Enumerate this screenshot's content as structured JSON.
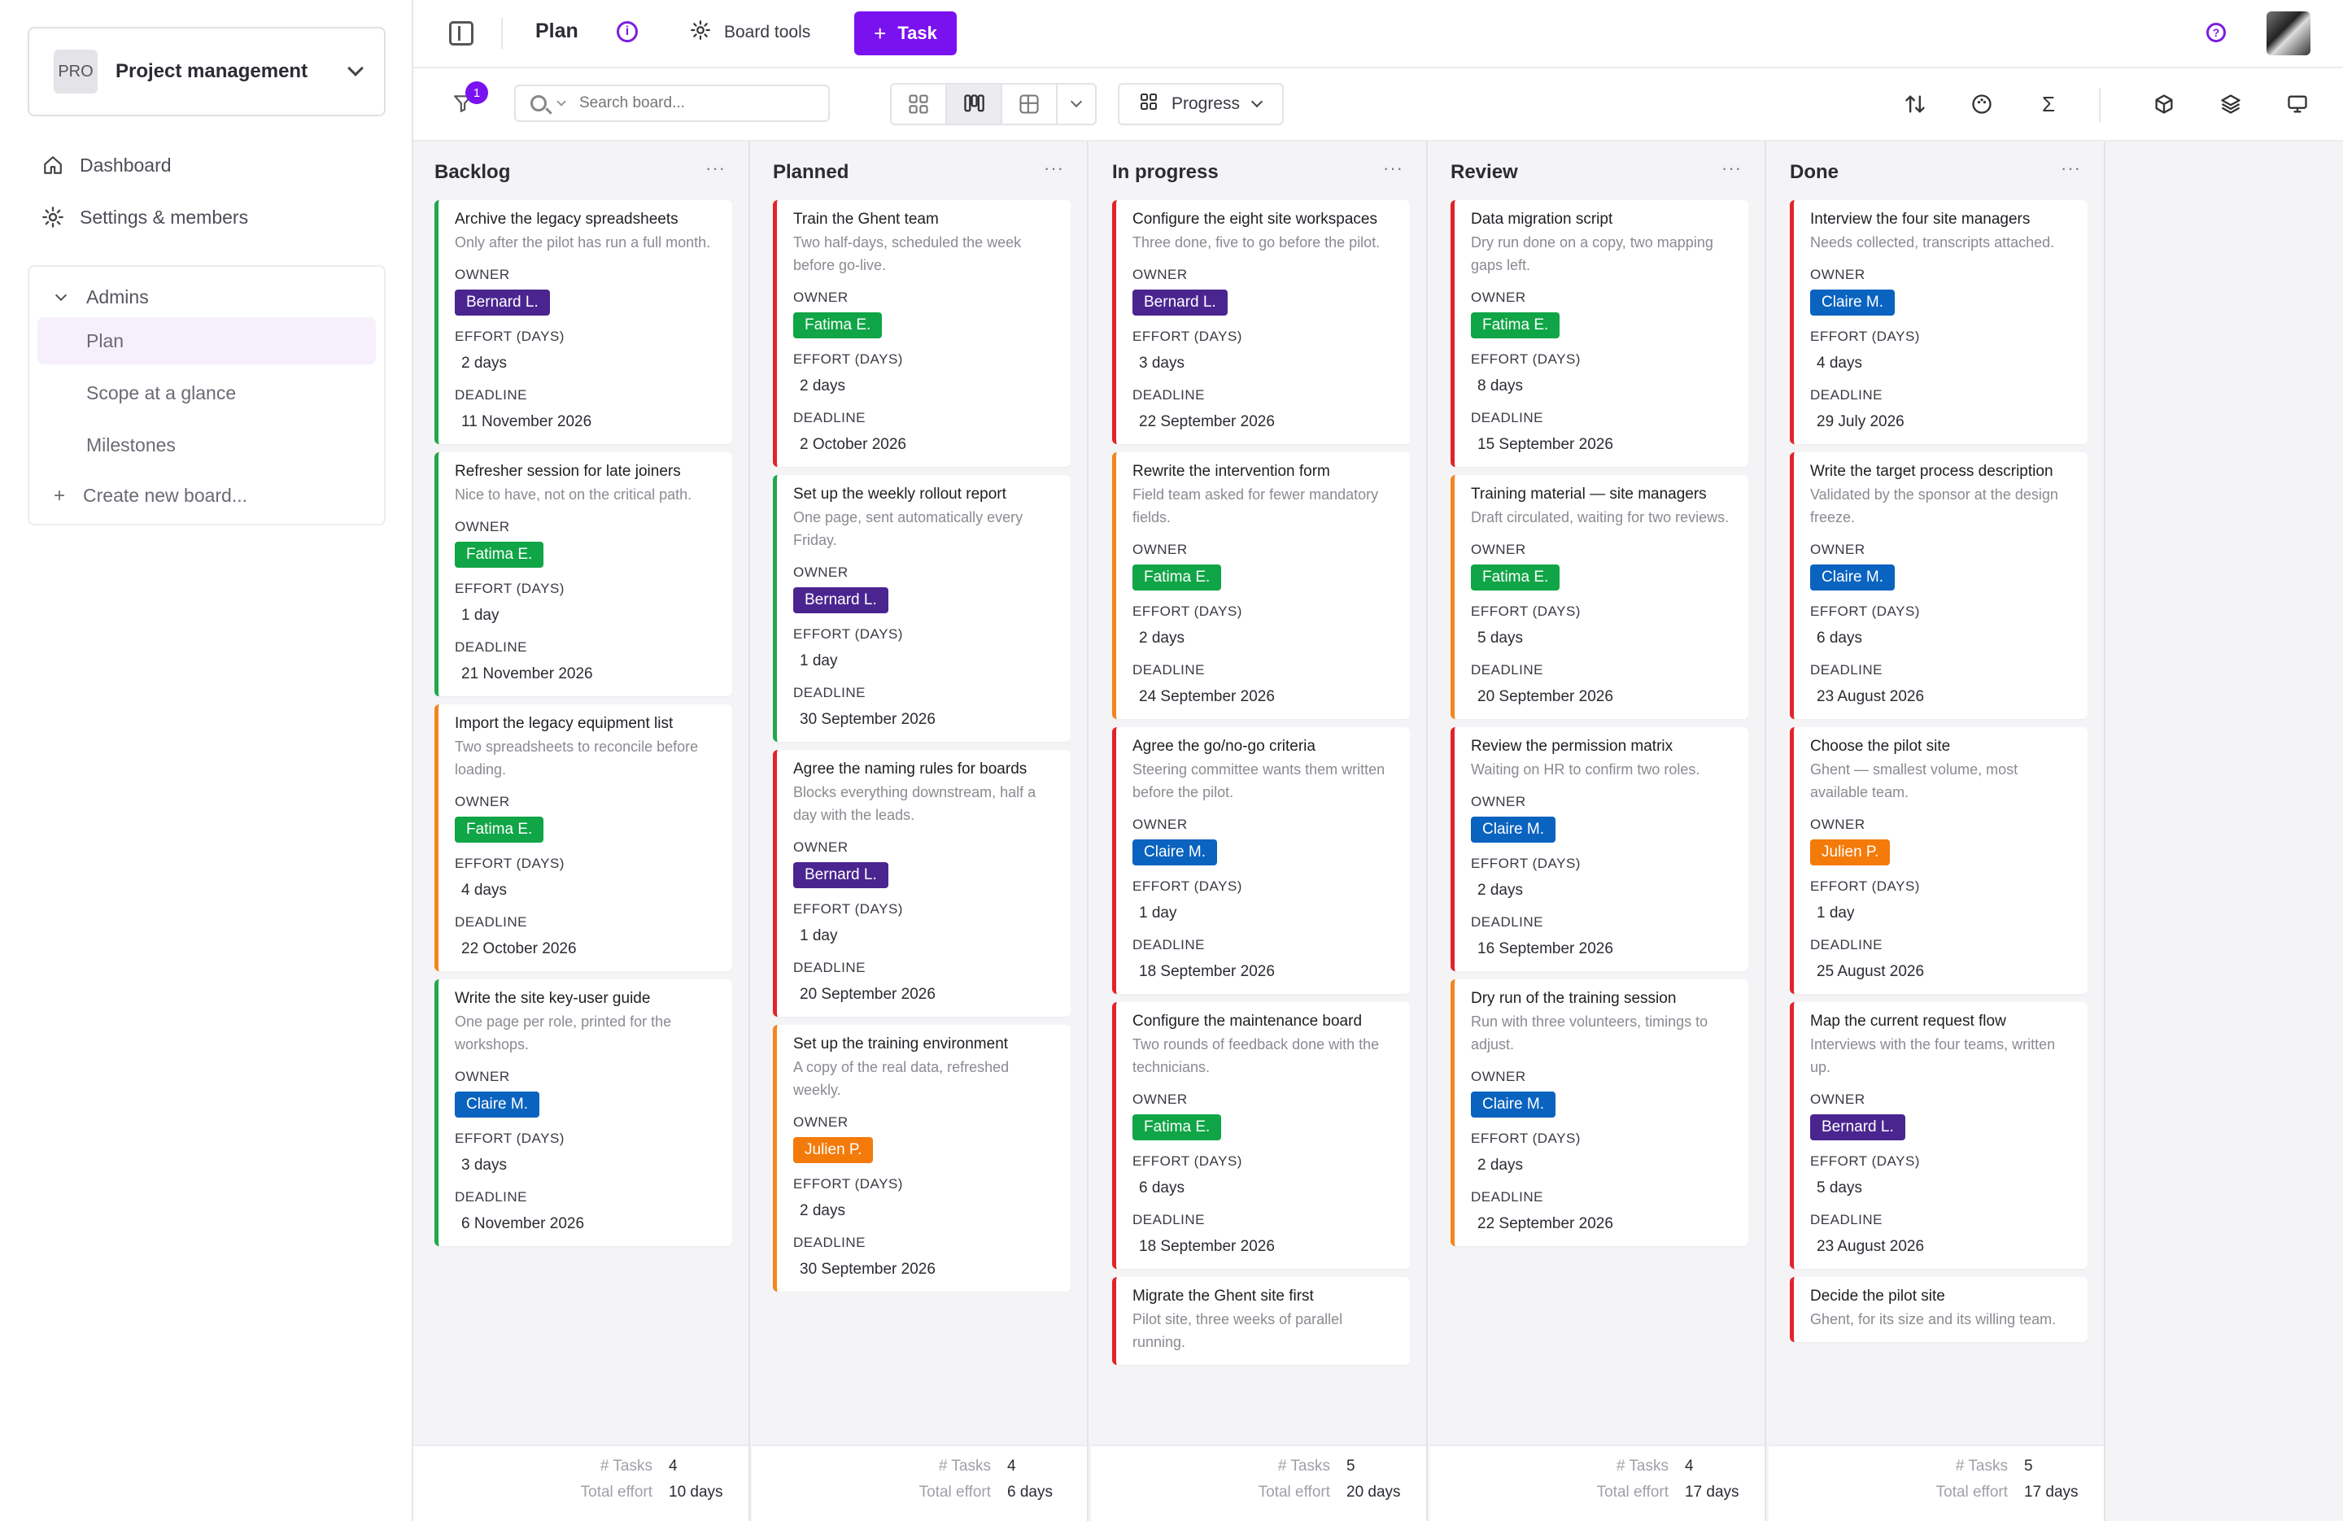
{
  "sidebar": {
    "project_badge": "PRO",
    "project_name": "Project management",
    "nav": [
      {
        "label": "Dashboard",
        "icon": "home-icon"
      },
      {
        "label": "Settings & members",
        "icon": "gear-icon"
      }
    ],
    "group_label": "Admins",
    "boards": [
      {
        "label": "Plan",
        "active": true
      },
      {
        "label": "Scope at a glance",
        "active": false
      },
      {
        "label": "Milestones",
        "active": false
      }
    ],
    "create_board": "Create new board..."
  },
  "topbar": {
    "title": "Plan",
    "board_tools": "Board tools",
    "task_button": "Task"
  },
  "toolbar": {
    "filter_count": "1",
    "search_placeholder": "Search board...",
    "group_by": "Progress"
  },
  "colors": {
    "accent": "#7a12f0",
    "bernard": "#4a2590",
    "fatima": "#10a546",
    "claire": "#0a63bf",
    "julien": "#f47a0a",
    "stripe_red": "#e2232a",
    "stripe_green": "#21a84c",
    "stripe_orange": "#f2861d"
  },
  "labels": {
    "owner": "OWNER",
    "effort": "EFFORT (DAYS)",
    "deadline": "DEADLINE",
    "tasks": "# Tasks",
    "total_effort": "Total effort"
  },
  "columns": [
    {
      "name": "Backlog",
      "task_count": "4",
      "total_effort": "10 days",
      "cards": [
        {
          "title": "Archive the legacy spreadsheets",
          "desc": "Only after the pilot has run a full month.",
          "owner": "Bernard L.",
          "owner_color": "bernard",
          "effort": "2 days",
          "deadline": "11 November 2026",
          "stripe": "green"
        },
        {
          "title": "Refresher session for late joiners",
          "desc": "Nice to have, not on the critical path.",
          "owner": "Fatima E.",
          "owner_color": "fatima",
          "effort": "1 day",
          "deadline": "21 November 2026",
          "stripe": "green"
        },
        {
          "title": "Import the legacy equipment list",
          "desc": "Two spreadsheets to reconcile before loading.",
          "owner": "Fatima E.",
          "owner_color": "fatima",
          "effort": "4 days",
          "deadline": "22 October 2026",
          "stripe": "orange"
        },
        {
          "title": "Write the site key-user guide",
          "desc": "One page per role, printed for the workshops.",
          "owner": "Claire M.",
          "owner_color": "claire",
          "effort": "3 days",
          "deadline": "6 November 2026",
          "stripe": "green"
        }
      ]
    },
    {
      "name": "Planned",
      "task_count": "4",
      "total_effort": "6 days",
      "cards": [
        {
          "title": "Train the Ghent team",
          "desc": "Two half-days, scheduled the week before go-live.",
          "owner": "Fatima E.",
          "owner_color": "fatima",
          "effort": "2 days",
          "deadline": "2 October 2026",
          "stripe": "red"
        },
        {
          "title": "Set up the weekly rollout report",
          "desc": "One page, sent automatically every Friday.",
          "owner": "Bernard L.",
          "owner_color": "bernard",
          "effort": "1 day",
          "deadline": "30 September 2026",
          "stripe": "green"
        },
        {
          "title": "Agree the naming rules for boards",
          "desc": "Blocks everything downstream, half a day with the leads.",
          "owner": "Bernard L.",
          "owner_color": "bernard",
          "effort": "1 day",
          "deadline": "20 September 2026",
          "stripe": "red"
        },
        {
          "title": "Set up the training environment",
          "desc": "A copy of the real data, refreshed weekly.",
          "owner": "Julien P.",
          "owner_color": "julien",
          "effort": "2 days",
          "deadline": "30 September 2026",
          "stripe": "orange"
        }
      ]
    },
    {
      "name": "In progress",
      "task_count": "5",
      "total_effort": "20 days",
      "cards": [
        {
          "title": "Configure the eight site workspaces",
          "desc": "Three done, five to go before the pilot.",
          "owner": "Bernard L.",
          "owner_color": "bernard",
          "effort": "3 days",
          "deadline": "22 September 2026",
          "stripe": "red"
        },
        {
          "title": "Rewrite the intervention form",
          "desc": "Field team asked for fewer mandatory fields.",
          "owner": "Fatima E.",
          "owner_color": "fatima",
          "effort": "2 days",
          "deadline": "24 September 2026",
          "stripe": "orange"
        },
        {
          "title": "Agree the go/no-go criteria",
          "desc": "Steering committee wants them written before the pilot.",
          "owner": "Claire M.",
          "owner_color": "claire",
          "effort": "1 day",
          "deadline": "18 September 2026",
          "stripe": "red"
        },
        {
          "title": "Configure the maintenance board",
          "desc": "Two rounds of feedback done with the technicians.",
          "owner": "Fatima E.",
          "owner_color": "fatima",
          "effort": "6 days",
          "deadline": "18 September 2026",
          "stripe": "red"
        },
        {
          "title": "Migrate the Ghent site first",
          "desc": "Pilot site, three weeks of parallel running.",
          "owner": "",
          "owner_color": "",
          "effort": "",
          "deadline": "",
          "stripe": "red"
        }
      ]
    },
    {
      "name": "Review",
      "task_count": "4",
      "total_effort": "17 days",
      "cards": [
        {
          "title": "Data migration script",
          "desc": "Dry run done on a copy, two mapping gaps left.",
          "owner": "Fatima E.",
          "owner_color": "fatima",
          "effort": "8 days",
          "deadline": "15 September 2026",
          "stripe": "red"
        },
        {
          "title": "Training material — site managers",
          "desc": "Draft circulated, waiting for two reviews.",
          "owner": "Fatima E.",
          "owner_color": "fatima",
          "effort": "5 days",
          "deadline": "20 September 2026",
          "stripe": "orange"
        },
        {
          "title": "Review the permission matrix",
          "desc": "Waiting on HR to confirm two roles.",
          "owner": "Claire M.",
          "owner_color": "claire",
          "effort": "2 days",
          "deadline": "16 September 2026",
          "stripe": "red"
        },
        {
          "title": "Dry run of the training session",
          "desc": "Run with three volunteers, timings to adjust.",
          "owner": "Claire M.",
          "owner_color": "claire",
          "effort": "2 days",
          "deadline": "22 September 2026",
          "stripe": "orange"
        }
      ]
    },
    {
      "name": "Done",
      "task_count": "5",
      "total_effort": "17 days",
      "cards": [
        {
          "title": "Interview the four site managers",
          "desc": "Needs collected, transcripts attached.",
          "owner": "Claire M.",
          "owner_color": "claire",
          "effort": "4 days",
          "deadline": "29 July 2026",
          "stripe": "red"
        },
        {
          "title": "Write the target process description",
          "desc": "Validated by the sponsor at the design freeze.",
          "owner": "Claire M.",
          "owner_color": "claire",
          "effort": "6 days",
          "deadline": "23 August 2026",
          "stripe": "red"
        },
        {
          "title": "Choose the pilot site",
          "desc": "Ghent — smallest volume, most available team.",
          "owner": "Julien P.",
          "owner_color": "julien",
          "effort": "1 day",
          "deadline": "25 August 2026",
          "stripe": "red"
        },
        {
          "title": "Map the current request flow",
          "desc": "Interviews with the four teams, written up.",
          "owner": "Bernard L.",
          "owner_color": "bernard",
          "effort": "5 days",
          "deadline": "23 August 2026",
          "stripe": "red"
        },
        {
          "title": "Decide the pilot site",
          "desc": "Ghent, for its size and its willing team.",
          "owner": "",
          "owner_color": "",
          "effort": "",
          "deadline": "",
          "stripe": "red"
        }
      ]
    }
  ]
}
